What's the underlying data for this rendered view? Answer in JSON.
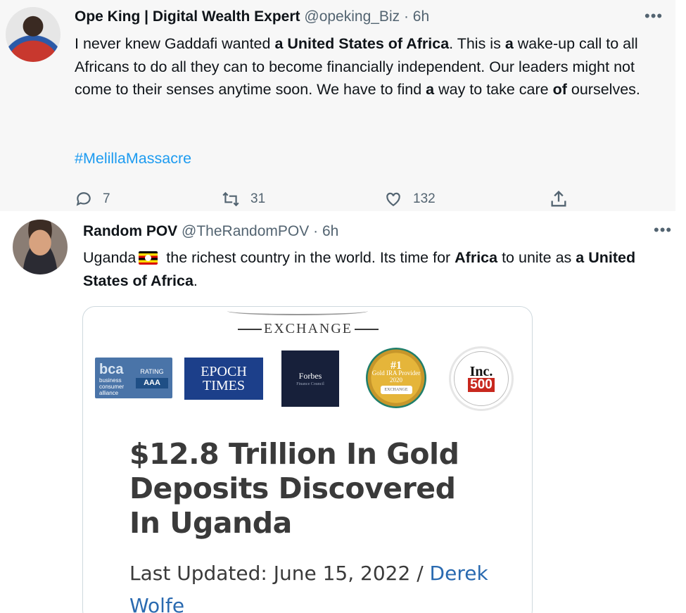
{
  "tweet1": {
    "name": "Ope King | Digital Wealth Expert",
    "handle": "@opeking_Biz",
    "time": "6h",
    "more": "•••",
    "body": [
      {
        "text": "I never knew Gaddafi wanted ",
        "bold": false
      },
      {
        "text": "a United States of Africa",
        "bold": true
      },
      {
        "text": ". This is ",
        "bold": false
      },
      {
        "text": "a",
        "bold": true
      },
      {
        "text": " wake-up call to all Africans to do all they can to become financially independent. Our leaders might not come to their senses anytime soon. We have to find ",
        "bold": false
      },
      {
        "text": "a",
        "bold": true
      },
      {
        "text": " way to take care ",
        "bold": false
      },
      {
        "text": "of",
        "bold": true
      },
      {
        "text": " ourselves.",
        "bold": false
      }
    ],
    "hashtag": "#MelillaMassacre",
    "replies": "7",
    "retweets": "31",
    "likes": "132"
  },
  "tweet2": {
    "name": "Random POV",
    "handle": "@TheRandomPOV",
    "time": "6h",
    "more": "•••",
    "body_a": "Uganda",
    "flag_icon": "uganda-flag-icon",
    "body_b": " the richest country in the world. Its time for ",
    "body_c": "Africa",
    "body_d": " to unite as ",
    "body_e": "a United States of Africa",
    "body_f": ".",
    "card": {
      "exchange": "EXCHANGE",
      "logos": {
        "bca_small": "business consumer alliance",
        "bca_rating": "RATING",
        "bca_grade": "AAA",
        "epoch_line1": "EPOCH",
        "epoch_line2": "TIMES",
        "forbes": "Forbes",
        "forbes_sub": "Finance Council",
        "gold_num": "#1",
        "gold_text": "Gold IRA Provider",
        "gold_year": "2020",
        "inc": "Inc.",
        "inc_num": "500"
      },
      "headline": "$12.8 Trillion In Gold Deposits Discovered In Uganda",
      "updated_label": "Last Updated:  June 15, 2022 / ",
      "author": "Derek Wolfe"
    }
  }
}
